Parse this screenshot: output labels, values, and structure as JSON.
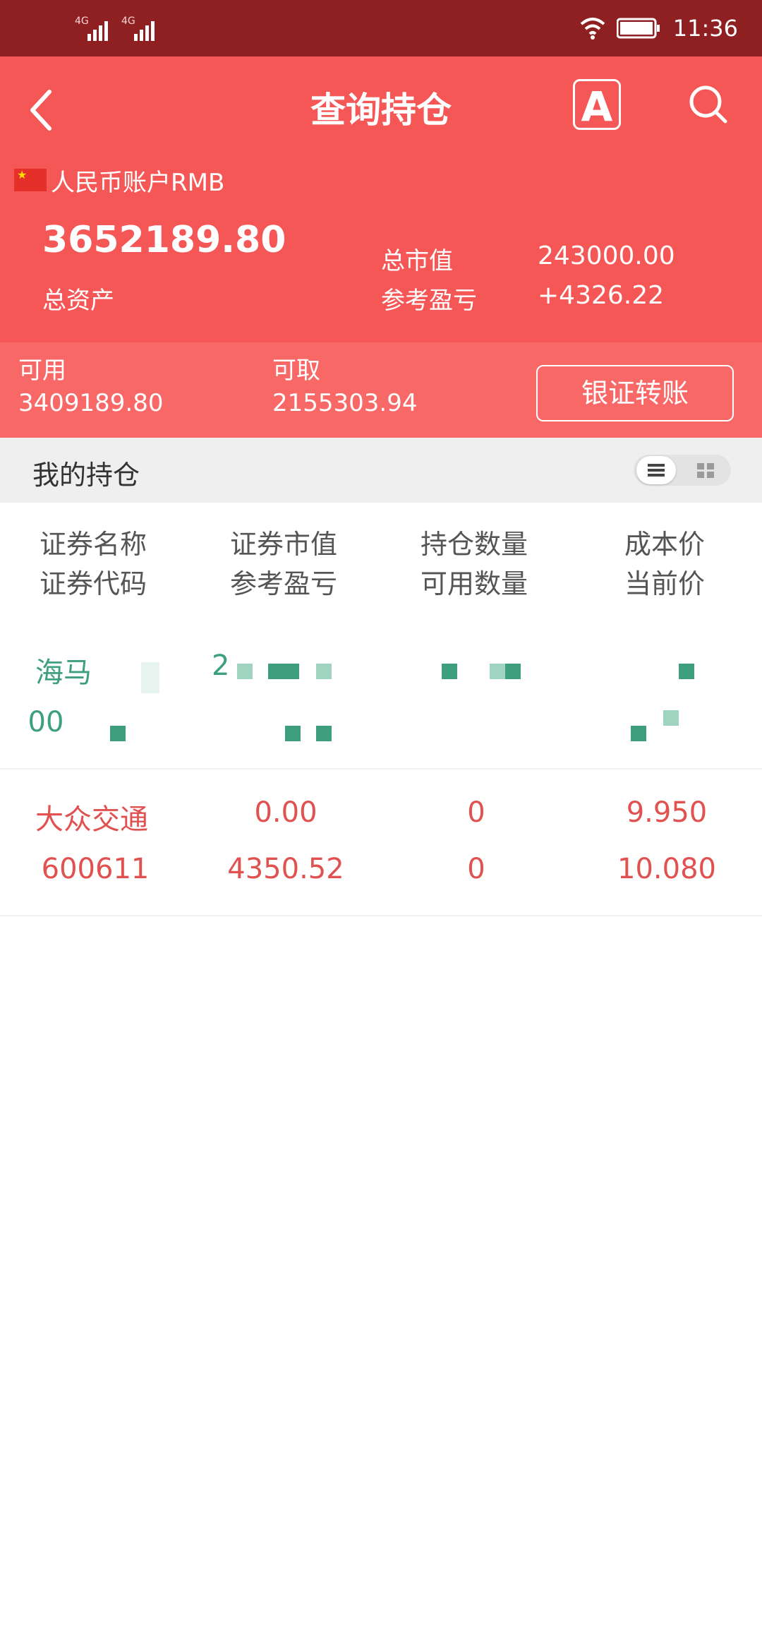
{
  "status_bar": {
    "network1": "4G",
    "network2": "4G",
    "time": "11:36"
  },
  "header": {
    "title": "查询持仓",
    "account_name": "人民币账户RMB",
    "total_assets_value": "3652189.80",
    "total_assets_label": "总资产",
    "market_value_label": "总市值",
    "market_value": "243000.00",
    "ref_pl_label": "参考盈亏",
    "ref_pl": "+4326.22",
    "a_icon_text": "A"
  },
  "available": {
    "usable_label": "可用",
    "usable_value": "3409189.80",
    "withdrawable_label": "可取",
    "withdrawable_value": "2155303.94",
    "transfer_button": "银证转账"
  },
  "positions": {
    "title": "我的持仓",
    "columns": [
      {
        "top": "证券名称",
        "bottom": "证券代码"
      },
      {
        "top": "证券市值",
        "bottom": "参考盈亏"
      },
      {
        "top": "持仓数量",
        "bottom": "可用数量"
      },
      {
        "top": "成本价",
        "bottom": "当前价"
      }
    ],
    "rows": [
      {
        "name": "海马",
        "code": "00",
        "market_value": "2",
        "pl": "",
        "qty": "",
        "avail_qty": "",
        "cost": "",
        "price": "",
        "color": "#3d9f7d"
      },
      {
        "name": "大众交通",
        "code": "600611",
        "market_value": "0.00",
        "pl": "4350.52",
        "qty": "0",
        "avail_qty": "0",
        "cost": "9.950",
        "price": "10.080",
        "color": "#e0514f"
      }
    ]
  },
  "colors": {
    "status_bar": "#8f2021",
    "header": "#f55756",
    "available_bar": "#f86867",
    "profit": "#e0514f",
    "loss": "#3d9f7d"
  }
}
